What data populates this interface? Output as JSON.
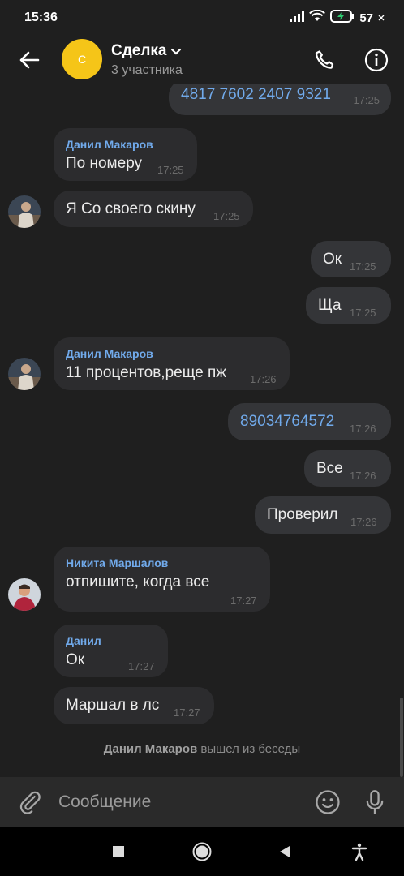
{
  "status_bar": {
    "time": "15:36",
    "battery": "57",
    "icons": [
      "signal-icon",
      "wifi-icon",
      "battery-charging-icon"
    ]
  },
  "header": {
    "avatar_letter": "С",
    "title": "Сделка",
    "subtitle": "3 участника",
    "avatar_color": "#f5c518"
  },
  "messages": [
    {
      "dir": "out",
      "text": "4817 7602 2407 9321",
      "time": "17:25",
      "link": true
    },
    {
      "dir": "in",
      "sender": "Данил Макаров",
      "text": "По номеру",
      "time": "17:25"
    },
    {
      "dir": "in",
      "text": "Я Со своего скину",
      "time": "17:25"
    },
    {
      "dir": "out",
      "text": "Ок",
      "time": "17:25"
    },
    {
      "dir": "out",
      "text": "Ща",
      "time": "17:25"
    },
    {
      "dir": "in",
      "sender": "Данил Макаров",
      "text": "11 процентов,реще пж",
      "time": "17:26"
    },
    {
      "dir": "out",
      "text": "89034764572",
      "time": "17:26",
      "link": true
    },
    {
      "dir": "out",
      "text": "Все",
      "time": "17:26"
    },
    {
      "dir": "out",
      "text": "Проверил",
      "time": "17:26"
    },
    {
      "dir": "in",
      "sender": "Никита Маршалов",
      "text": "отпишите, когда все",
      "time": "17:27"
    },
    {
      "dir": "in",
      "sender": "Данил",
      "text": "Ок",
      "time": "17:27"
    },
    {
      "dir": "in",
      "text": "Маршал в лс",
      "time": "17:27"
    }
  ],
  "system_message": {
    "name": "Данил Макаров",
    "action": "вышел из беседы"
  },
  "composer": {
    "placeholder": "Сообщение"
  },
  "colors": {
    "background": "#1f1f1f",
    "bubble_in": "#2c2c2e",
    "bubble_out": "#343538",
    "accent": "#71aaeb"
  }
}
